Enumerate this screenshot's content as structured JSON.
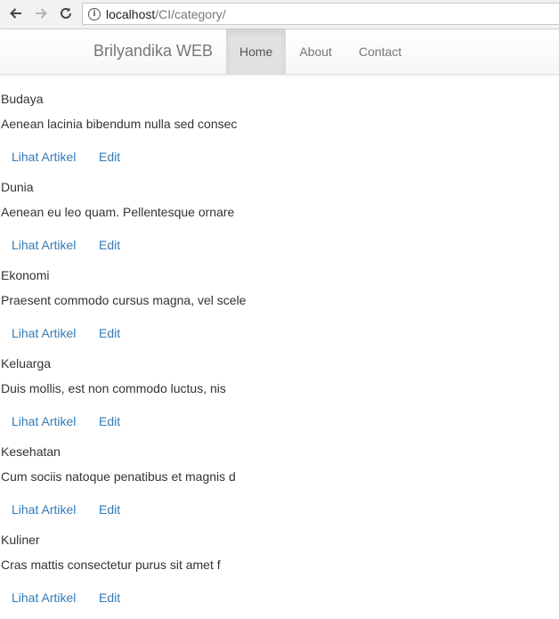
{
  "browser": {
    "url_host": "localhost",
    "url_path": "/CI/category/"
  },
  "navbar": {
    "brand": "Brilyandika WEB",
    "items": [
      {
        "label": "Home",
        "active": true
      },
      {
        "label": "About",
        "active": false
      },
      {
        "label": "Contact",
        "active": false
      }
    ]
  },
  "categories": [
    {
      "name": "Budaya",
      "description": "Aenean lacinia bibendum nulla sed consec",
      "view_label": "Lihat Artikel",
      "edit_label": "Edit"
    },
    {
      "name": "Dunia",
      "description": "Aenean eu leo quam. Pellentesque ornare",
      "view_label": "Lihat Artikel",
      "edit_label": "Edit"
    },
    {
      "name": "Ekonomi",
      "description": "Praesent commodo cursus magna, vel scele",
      "view_label": "Lihat Artikel",
      "edit_label": "Edit"
    },
    {
      "name": "Keluarga",
      "description": "Duis mollis, est non commodo luctus, nis",
      "view_label": "Lihat Artikel",
      "edit_label": "Edit"
    },
    {
      "name": "Kesehatan",
      "description": "Cum sociis natoque penatibus et magnis d",
      "view_label": "Lihat Artikel",
      "edit_label": "Edit"
    },
    {
      "name": "Kuliner",
      "description": "Cras mattis consectetur purus sit amet f",
      "view_label": "Lihat Artikel",
      "edit_label": "Edit"
    }
  ],
  "colors": {
    "link": "#337ab7",
    "text": "#333333",
    "navbar_text": "#777777",
    "nav_active_bg": "#e1e1e1"
  }
}
